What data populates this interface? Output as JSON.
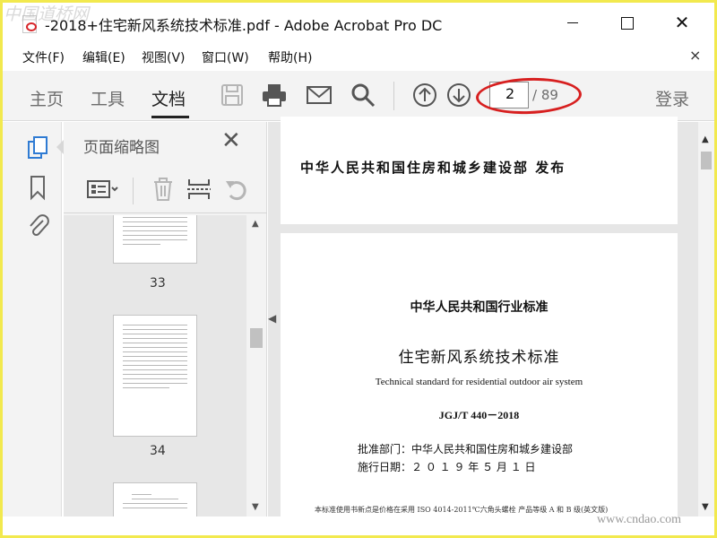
{
  "window": {
    "title": "-2018+住宅新风系统技术标准.pdf - Adobe Acrobat Pro DC",
    "minimize_label": "—",
    "close_label": "✕"
  },
  "menu": {
    "items": [
      {
        "label": "文件(F)"
      },
      {
        "label": "编辑(E)"
      },
      {
        "label": "视图(V)"
      },
      {
        "label": "窗口(W)"
      },
      {
        "label": "帮助(H)"
      }
    ],
    "close_label": "×"
  },
  "toolbar": {
    "tabs": [
      {
        "label": "主页"
      },
      {
        "label": "工具"
      },
      {
        "label": "文档",
        "active": true
      }
    ],
    "icons": [
      "save-icon",
      "print-icon",
      "email-icon",
      "search-icon",
      "page-up-icon",
      "page-down-icon"
    ],
    "page_current": "2",
    "page_total": "/ 89",
    "login_label": "登录",
    "highlight_color": "#d71f1f"
  },
  "rail": {
    "icons": [
      "page-thumbnails-icon",
      "bookmarks-icon",
      "attachments-icon"
    ],
    "accent_color": "#2f7bd3"
  },
  "thumbnail_panel": {
    "title": "页面缩略图",
    "close_label": "✕",
    "tool_icons": [
      "options-icon",
      "delete-icon",
      "extract-icon",
      "undo-icon"
    ],
    "thumbnails": [
      {
        "label": "33"
      },
      {
        "label": "34"
      }
    ]
  },
  "document": {
    "page1": {
      "publisher": "中华人民共和国住房和城乡建设部   发布"
    },
    "page2": {
      "line1": "中华人民共和国行业标准",
      "line2": "住宅新风系统技术标准",
      "line3": "Technical standard for residential outdoor air system",
      "line4": "JGJ/T 440－2018",
      "approval": "批准部门：中华人民共和国住房和城乡建设部",
      "effective": "施行日期：２  ０  １  ９  年  ５  月  １  日",
      "footer": "本标准使用书新点是价格在采用 ISO 4014-2011℃六角头螺栓  产品等级 A 和 B 级(英文版)"
    }
  },
  "watermarks": {
    "top": "中国道桥网",
    "bottom": "www.cndao.com"
  }
}
